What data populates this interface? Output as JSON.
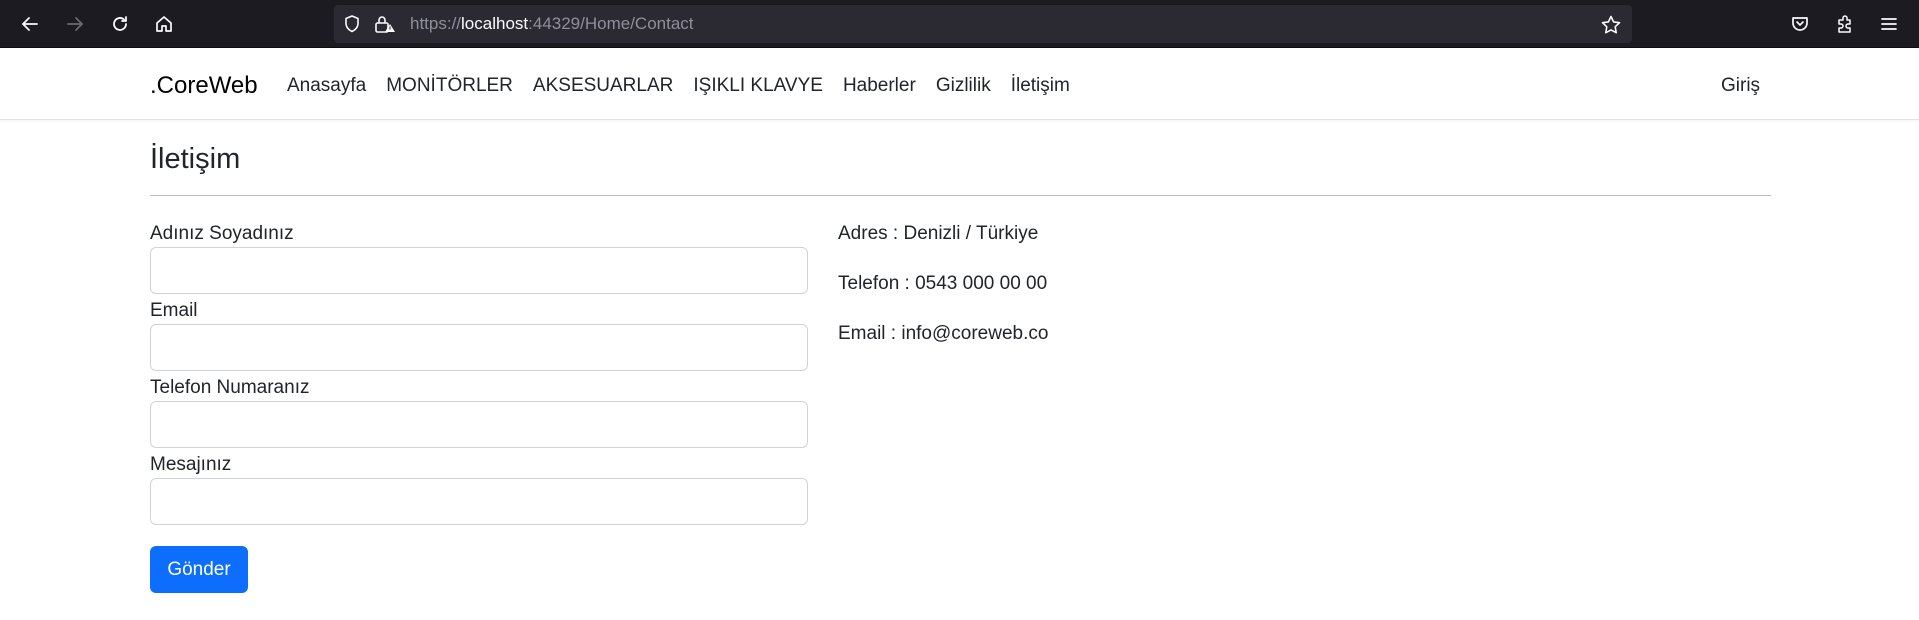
{
  "browser": {
    "url_scheme": "https://",
    "url_host": "localhost",
    "url_rest": ":44329/Home/Contact"
  },
  "navbar": {
    "brand": ".CoreWeb",
    "links": [
      "Anasayfa",
      "MONİTÖRLER",
      "AKSESUARLAR",
      "IŞIKLI KLAVYE",
      "Haberler",
      "Gizlilik",
      "İletişim"
    ],
    "login": "Giriş"
  },
  "page": {
    "title": "İletişim"
  },
  "form": {
    "name_label": "Adınız Soyadınız",
    "email_label": "Email",
    "phone_label": "Telefon Numaranız",
    "message_label": "Mesajınız",
    "submit_label": "Gönder"
  },
  "contact_info": {
    "address": "Adres : Denizli / Türkiye",
    "phone": "Telefon : 0543 000 00 00",
    "email": "Email : info@coreweb.co"
  },
  "colors": {
    "accent": "#0d6efd",
    "toolbar_bg": "#1c1b22"
  }
}
